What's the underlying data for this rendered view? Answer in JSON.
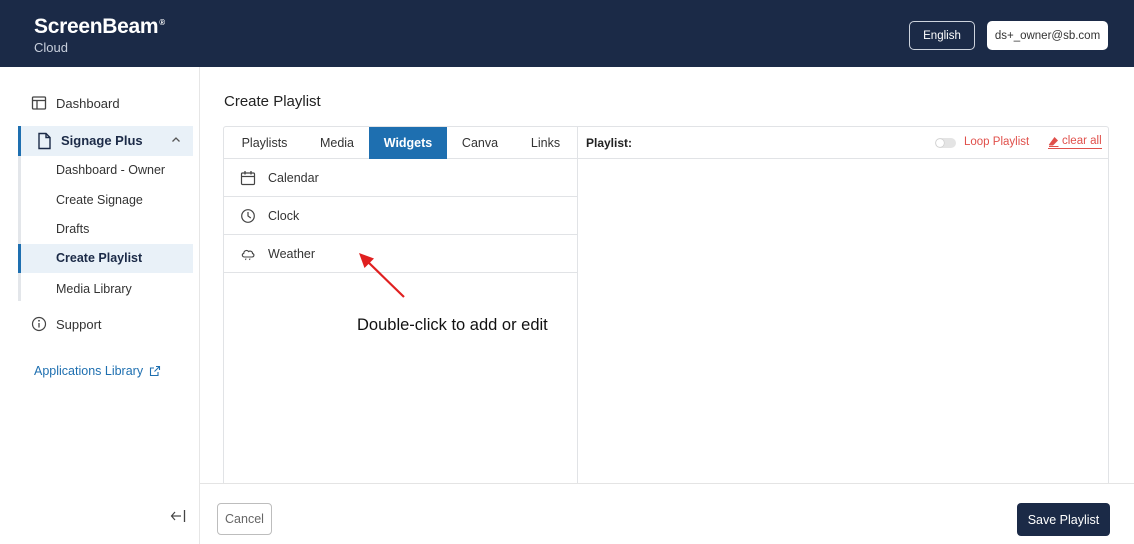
{
  "header": {
    "brand": "ScreenBeam",
    "brand_mark": "®",
    "brand_sub": "Cloud",
    "language_label": "English",
    "user_label": "ds+_owner@sb.com"
  },
  "sidebar": {
    "dashboard_label": "Dashboard",
    "signage_label": "Signage Plus",
    "signage_items": [
      "Dashboard - Owner",
      "Create Signage",
      "Drafts",
      "Create Playlist",
      "Media Library"
    ],
    "active_item": "Create Playlist",
    "support_label": "Support",
    "apps_library_label": "Applications Library",
    "collapse_icon": "collapse-left-icon"
  },
  "main": {
    "page_title": "Create Playlist",
    "tabs": [
      "Playlists",
      "Media",
      "Widgets",
      "Canva",
      "Links"
    ],
    "active_tab": "Widgets",
    "widgets": [
      {
        "label": "Calendar",
        "icon": "calendar-icon"
      },
      {
        "label": "Clock",
        "icon": "clock-icon"
      },
      {
        "label": "Weather",
        "icon": "cloud-icon"
      }
    ],
    "playlist_label": "Playlist:",
    "loop_label": "Loop Playlist",
    "loop_enabled": false,
    "clear_all_label": "clear all",
    "annotation": "Double-click to add or edit"
  },
  "footer": {
    "cancel_label": "Cancel",
    "save_label": "Save Playlist"
  },
  "colors": {
    "header_bg": "#1b2a47",
    "accent": "#1e6fb0",
    "danger": "#e0504b",
    "annotation_arrow": "#e02020"
  }
}
